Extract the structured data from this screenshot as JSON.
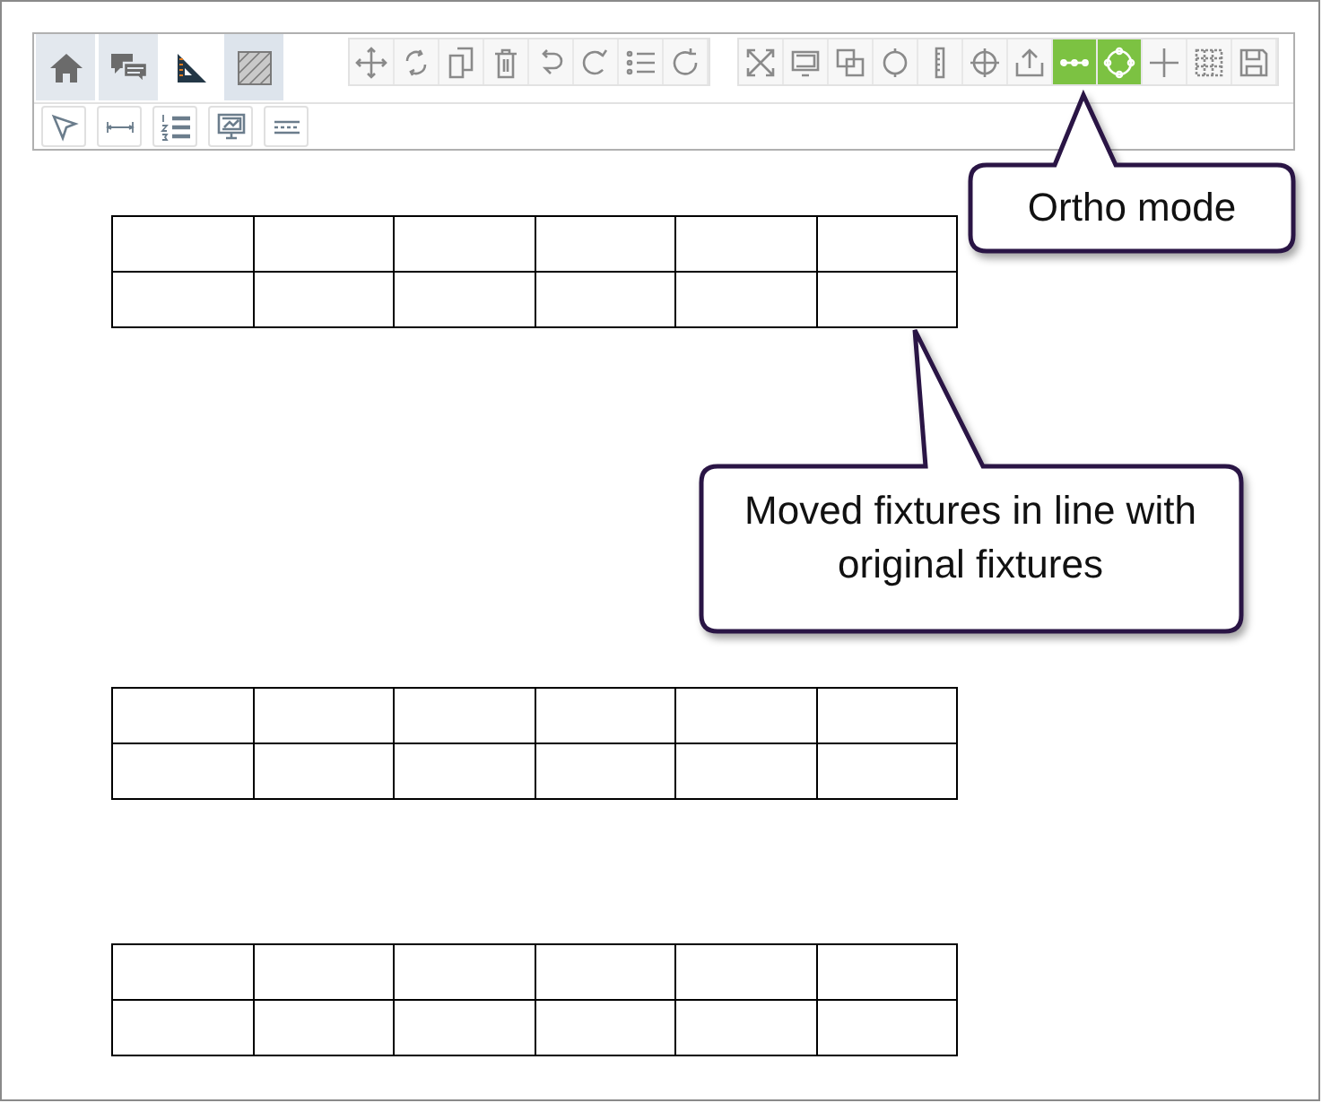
{
  "tabs": [
    {
      "selected": false
    },
    {
      "selected": false
    },
    {
      "selected": true
    },
    {
      "selected": false
    }
  ],
  "toolbar_groups": [
    {
      "buttons": [
        {
          "active": false
        },
        {
          "active": false
        },
        {
          "active": false
        },
        {
          "active": false
        },
        {
          "active": false
        },
        {
          "active": false
        },
        {
          "active": false
        },
        {
          "active": false
        }
      ]
    },
    {
      "buttons": [
        {
          "active": false
        },
        {
          "active": false
        },
        {
          "active": false
        },
        {
          "active": false
        },
        {
          "active": false
        },
        {
          "active": false
        },
        {
          "active": false
        },
        {
          "active": true
        },
        {
          "active": true
        },
        {
          "active": false
        },
        {
          "active": false
        },
        {
          "active": false
        }
      ]
    }
  ],
  "secondary_buttons": [
    {
      "active": false
    },
    {
      "active": false
    },
    {
      "active": false
    },
    {
      "active": false
    },
    {
      "active": false
    }
  ],
  "callouts": [
    {
      "text": "Ortho mode"
    },
    {
      "text": "Moved fixtures in line with original fixtures"
    }
  ]
}
